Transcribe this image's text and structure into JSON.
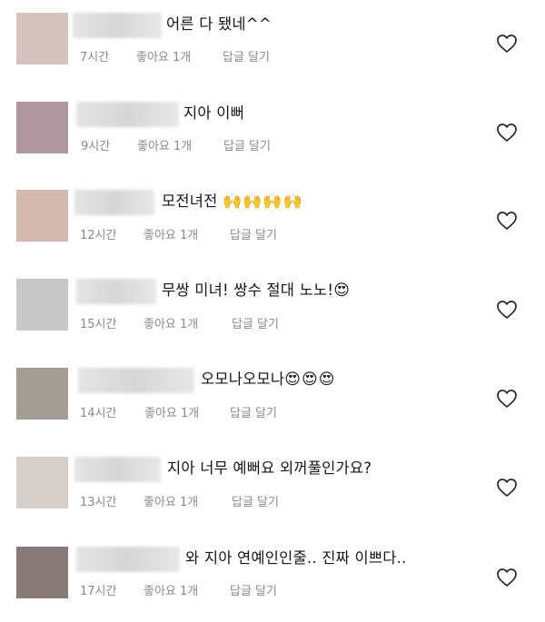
{
  "comments": [
    {
      "text": "어른 다 됐네^^",
      "emoji": "",
      "time": "7시간",
      "likes": "좋아요 1개",
      "reply": "답글 달기",
      "avatar_color": "#d5c3be"
    },
    {
      "text": "지아 이뻐",
      "emoji": "",
      "time": "9시간",
      "likes": "좋아요 1개",
      "reply": "답글 달기",
      "avatar_color": "#b0979f"
    },
    {
      "text": "모전녀전",
      "emoji": "🙌🙌🙌🙌",
      "time": "12시간",
      "likes": "좋아요 1개",
      "reply": "답글 달기",
      "avatar_color": "#d4b9ae"
    },
    {
      "text": "무쌍 미녀! 쌍수 절대 노노!",
      "emoji": "😍",
      "time": "15시간",
      "likes": "좋아요 1개",
      "reply": "답글 달기",
      "avatar_color": "#c8c8c8"
    },
    {
      "text": "오모나오모나",
      "emoji": "😍😍😍",
      "time": "14시간",
      "likes": "좋아요 1개",
      "reply": "답글 달기",
      "avatar_color": "#a39d96"
    },
    {
      "text": "지아 너무 예뻐요 외꺼풀인가요?",
      "emoji": "",
      "time": "13시간",
      "likes": "좋아요 1개",
      "reply": "답글 달기",
      "avatar_color": "#d6cfc9"
    },
    {
      "text": "와 지아 연예인인줄.. 진짜 이쁘다..",
      "emoji": "",
      "time": "17시간",
      "likes": "좋아요 1개",
      "reply": "답글 달기",
      "avatar_color": "#877a78"
    }
  ],
  "icons": {
    "like": "heart-outline-icon"
  }
}
